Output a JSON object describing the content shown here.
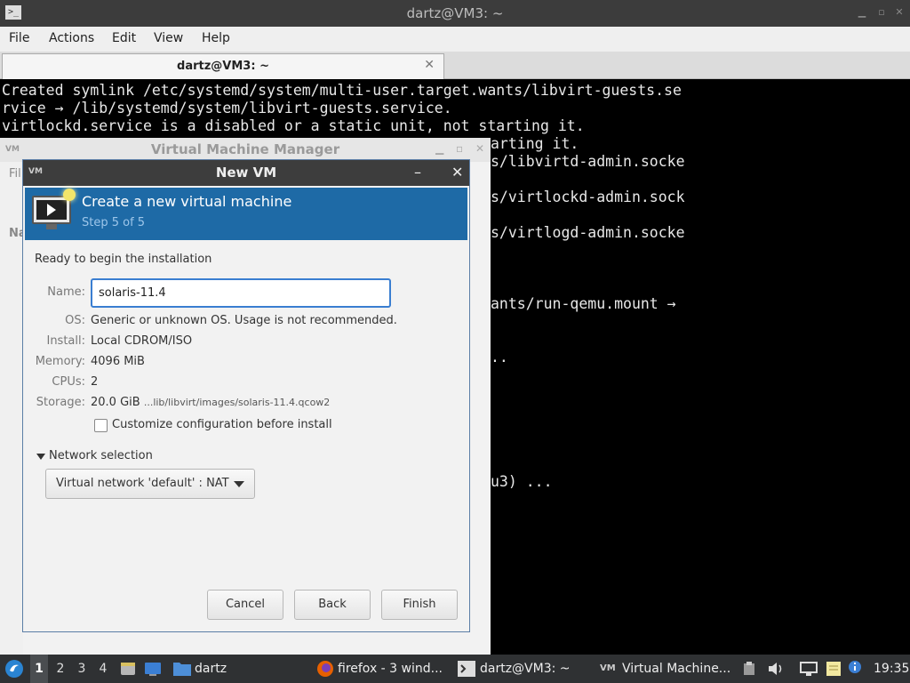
{
  "terminal": {
    "window_title": "dartz@VM3: ~",
    "menu": [
      "File",
      "Actions",
      "Edit",
      "View",
      "Help"
    ],
    "tab_label": "dartz@VM3: ~",
    "lines": [
      "Created symlink /etc/systemd/system/multi-user.target.wants/libvirt-guests.se",
      "rvice → /lib/systemd/system/libvirt-guests.service.",
      "virtlockd.service is a disabled or a static unit, not starting it."
    ],
    "partial_lines": [
      "arting it.",
      "s/libvirtd-admin.socke",
      "s/virtlockd-admin.sock",
      "s/virtlogd-admin.socke",
      "ants/run-qemu.mount →",
      "..",
      "u3) ..."
    ]
  },
  "vmm": {
    "window_title": "Virtual Machine Manager",
    "side_fragments": [
      "Fil",
      "Na"
    ]
  },
  "dialog": {
    "title": "New VM",
    "header_title": "Create a new virtual machine",
    "header_step": "Step 5 of 5",
    "ready_text": "Ready to begin the installation",
    "name_label": "Name:",
    "name_value": "solaris-11.4",
    "details": [
      {
        "label": "OS:",
        "value": "Generic or unknown OS. Usage is not recommended."
      },
      {
        "label": "Install:",
        "value": "Local CDROM/ISO"
      },
      {
        "label": "Memory:",
        "value": "4096 MiB"
      },
      {
        "label": "CPUs:",
        "value": "2"
      },
      {
        "label": "Storage:",
        "value": "20.0 GiB",
        "path": "...lib/libvirt/images/solaris-11.4.qcow2"
      }
    ],
    "customize_label": "Customize configuration before install",
    "customize_checked": false,
    "network_expander_label": "Network selection",
    "network_selected": "Virtual network 'default' : NAT",
    "buttons": {
      "cancel": "Cancel",
      "back": "Back",
      "finish": "Finish"
    },
    "header_color": "#1e6aa6"
  },
  "taskbar": {
    "workspaces": [
      "1",
      "2",
      "3",
      "4"
    ],
    "active_workspace": "1",
    "folder_label": "dartz",
    "tasks": [
      "firefox - 3 wind...",
      "dartz@VM3: ~",
      "Virtual Machine..."
    ],
    "clock": "19:35"
  }
}
